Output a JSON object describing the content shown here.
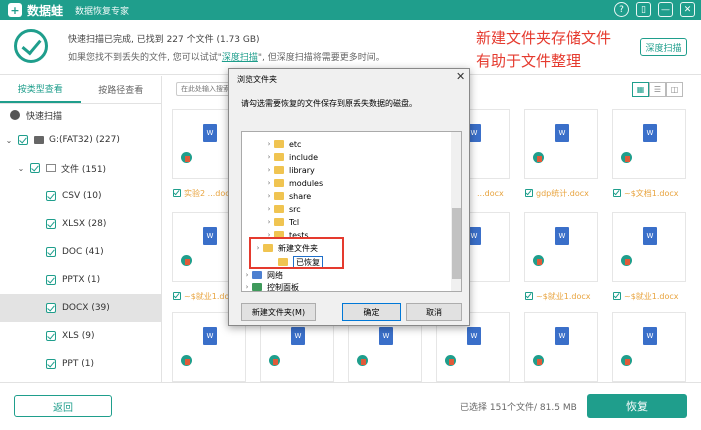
{
  "app": {
    "name": "数据蛙",
    "subtitle": "数据恢复专家",
    "logo_glyph": "+",
    "window_controls": [
      "?",
      "▯",
      "—",
      "✕"
    ]
  },
  "status": {
    "line1": "快速扫描已完成, 已找到 227 个文件 (1.73 GB)",
    "line2_prefix": "如果您找不到丢失的文件, 您可以试试\"",
    "line2_link": "深度扫描",
    "line2_suffix": "\", 但深度扫描将需要更多时间。",
    "deep_scan_button": "深度扫描"
  },
  "annotation": {
    "line1": "新建文件夹存储文件",
    "line2": "有助于文件整理"
  },
  "sidebar": {
    "tabs": [
      "按类型查看",
      "按路径查看"
    ],
    "active_tab": 0,
    "quick_scan": "快速扫描",
    "items": [
      {
        "label": "G:(FAT32) (227)",
        "level": 0
      },
      {
        "label": "文件 (151)",
        "level": 1
      },
      {
        "label": "CSV (10)",
        "level": 2
      },
      {
        "label": "XLSX (28)",
        "level": 2
      },
      {
        "label": "DOC (41)",
        "level": 2
      },
      {
        "label": "PPTX (1)",
        "level": 2
      },
      {
        "label": "DOCX (39)",
        "level": 2,
        "selected": true
      },
      {
        "label": "XLS (9)",
        "level": 2
      },
      {
        "label": "PPT (1)",
        "level": 2
      }
    ]
  },
  "toolbar": {
    "search_placeholder": "在此处输入搜索"
  },
  "files": [
    {
      "name": "实验2 ...docx"
    },
    {
      "name": "...docx"
    },
    {
      "name": "...docx"
    },
    {
      "name": "...docx"
    },
    {
      "name": "gdp统计.docx"
    },
    {
      "name": "~$文档1.docx"
    },
    {
      "name": "~$就业1.docx"
    },
    {
      "name": "~$就业1.docx"
    },
    {
      "name": "~$就业1.docx"
    }
  ],
  "doc_glyph": "W",
  "dialog": {
    "title": "浏览文件夹",
    "close": "✕",
    "message": "请勾选需要恢复的文件保存到原丢失数据的磁盘。",
    "folders": [
      "etc",
      "include",
      "library",
      "modules",
      "share",
      "src",
      "Tcl",
      "tests"
    ],
    "new_folder": "新建文件夹",
    "editing_name": "已恢复",
    "network": "网络",
    "control_panel": "控制面板",
    "btn_new": "新建文件夹(M)",
    "btn_ok": "确定",
    "btn_cancel": "取消"
  },
  "bottom": {
    "back": "返回",
    "selection": "已选择 151个文件/ 81.5 MB",
    "recover": "恢复"
  }
}
